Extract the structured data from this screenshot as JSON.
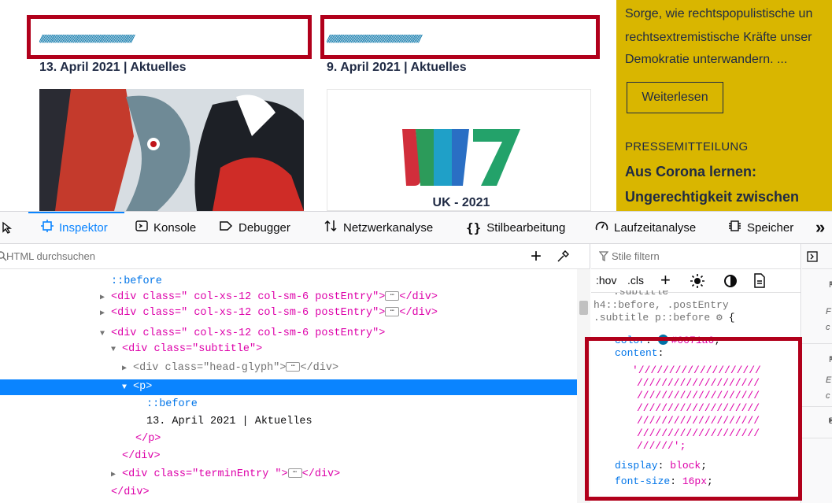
{
  "webpage": {
    "post1": {
      "slashes": "////////////////////////////////////////////////////////////////////",
      "date": "13. April 2021 | Aktuelles"
    },
    "post2": {
      "slashes": "////////////////////////////////////////////////////////////////////",
      "date": "9. April 2021 | Aktuelles"
    },
    "logo_text": "UK - 2021",
    "sidebar": {
      "line1": "Sorge, wie rechtspopulistische un",
      "line2": "rechtsextremistische Kräfte unser",
      "line3": "Demokratie unterwandern. ...",
      "button": "Weiterlesen",
      "label": "PRESSEMITTEILUNG",
      "title1": "Aus Corona lernen:",
      "title2": "Ungerechtigkeit zwischen"
    }
  },
  "toolbar": {
    "tabs": [
      {
        "label": "Inspektor",
        "icon": "inspector-icon"
      },
      {
        "label": "Konsole",
        "icon": "console-icon"
      },
      {
        "label": "Debugger",
        "icon": "debugger-icon"
      },
      {
        "label": "Netzwerkanalyse",
        "icon": "network-icon"
      },
      {
        "label": "Stilbearbeitung",
        "icon": "style-editor-icon"
      },
      {
        "label": "Laufzeitanalyse",
        "icon": "performance-icon"
      },
      {
        "label": "Speicher",
        "icon": "memory-icon"
      }
    ],
    "overflow": "»"
  },
  "markup": {
    "search_placeholder": "HTML durchsuchen",
    "lines": {
      "l0": "::before",
      "l1a": "<div class=\" col-xs-12 col-sm-6 postEntry\">",
      "l1b": "</div>",
      "l2a": "<div class=\" col-xs-12 col-sm-6 postEntry\">",
      "l2b": "</div>",
      "l3a": "<div class=\" col-xs-12 col-sm-6 postEntry\">",
      "l4a": "<div class=\"subtitle\">",
      "l5a": "<div class=\"head-glyph\">",
      "l5b": "</div>",
      "l6a": "<p>",
      "l7": "::before",
      "l8": "13. April 2021 | Aktuelles",
      "l9": "</p>",
      "l10": "</div>",
      "l11a": "<div class=\"terminEntry \">",
      "l11b": "</div>",
      "l12": "</div>"
    },
    "ellipsis": "⋯"
  },
  "rules": {
    "filter_placeholder": "Stile filtern",
    "tools": {
      "hov": ":hov",
      "cls": ".cls",
      "add": "+"
    },
    "selector_top": ".subtitle",
    "selector1": "h4::before, .postEntry",
    "selector2": ".subtitle p::before",
    "brace": "{",
    "color_prop": "color",
    "color_val": "#0071a6",
    "content_prop": "content",
    "content_lines": [
      "'////////////////////",
      "////////////////////",
      "////////////////////",
      "////////////////////",
      "////////////////////",
      "////////////////////",
      "//////';"
    ],
    "display_prop": "display",
    "display_val": "block",
    "font_prop": "font-size",
    "font_val": "16px"
  },
  "side": {
    "r1": "F",
    "r1a": "F",
    "r1b": "c",
    "r2": "F",
    "r2a": "E",
    "r2b": "c",
    "r3": "E"
  },
  "colors": {
    "accent": "#0a84ff",
    "highlight": "#b1001b",
    "yellow": "#d9b600",
    "slash": "#0071a6"
  }
}
